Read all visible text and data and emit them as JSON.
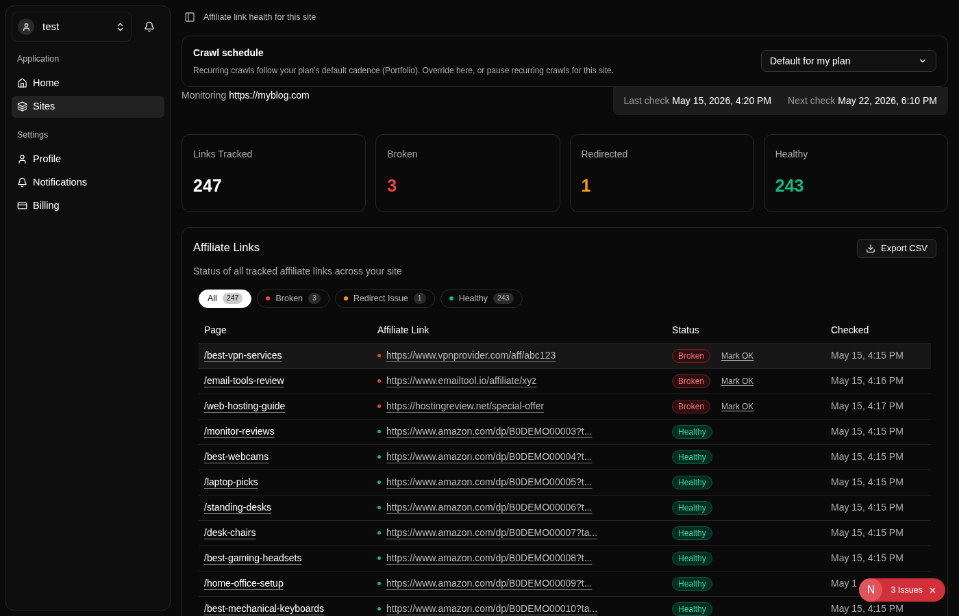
{
  "sidebar": {
    "user": {
      "name": "test"
    },
    "sections": [
      {
        "title": "Application",
        "items": [
          {
            "label": "Home",
            "selected": false
          },
          {
            "label": "Sites",
            "selected": true
          }
        ]
      },
      {
        "title": "Settings",
        "items": [
          {
            "label": "Profile",
            "selected": false
          },
          {
            "label": "Notifications",
            "selected": false
          },
          {
            "label": "Billing",
            "selected": false
          }
        ]
      }
    ]
  },
  "header": {
    "title": "Affiliate link health for this site"
  },
  "crawl_schedule": {
    "title": "Crawl schedule",
    "description": "Recurring crawls follow your plan’s default cadence (Portfolio). Override here, or pause recurring crawls for this site.",
    "select_value": "Default for my plan"
  },
  "monitoring": {
    "label": "Monitoring",
    "url": "https://myblog.com",
    "last_check_label": "Last check",
    "last_check": "May 15, 2026, 4:20 PM",
    "next_check_label": "Next check",
    "next_check": "May 22, 2026, 6:10 PM"
  },
  "stats": [
    {
      "label": "Links Tracked",
      "value": "247",
      "color": "#ffffff"
    },
    {
      "label": "Broken",
      "value": "3",
      "color": "#ef4444"
    },
    {
      "label": "Redirected",
      "value": "1",
      "color": "#f59e0b"
    },
    {
      "label": "Healthy",
      "value": "243",
      "color": "#10b981"
    }
  ],
  "links_panel": {
    "title": "Affiliate Links",
    "subtitle": "Status of all tracked affiliate links across your site",
    "export_button": "Export CSV",
    "filters": [
      {
        "label": "All",
        "count": "247",
        "selected": true
      },
      {
        "label": "Broken",
        "count": "3",
        "selected": false,
        "color": "#ef4444"
      },
      {
        "label": "Redirect Issue",
        "count": "1",
        "selected": false,
        "color": "#f59e0b"
      },
      {
        "label": "Healthy",
        "count": "243",
        "selected": false,
        "color": "#10b981"
      }
    ],
    "columns": [
      "Page",
      "Affiliate Link",
      "Status",
      "Checked"
    ],
    "rows": [
      {
        "page": "/best-vpn-services",
        "link": "https://www.vpnprovider.com/aff/abc123",
        "status": "Broken",
        "kind": "broken",
        "action": "Mark OK",
        "checked": "May 15, 4:15 PM",
        "selected": true
      },
      {
        "page": "/email-tools-review",
        "link": "https://www.emailtool.io/affiliate/xyz",
        "status": "Broken",
        "kind": "broken",
        "action": "Mark OK",
        "checked": "May 15, 4:16 PM",
        "selected": false
      },
      {
        "page": "/web-hosting-guide",
        "link": "https://hostingreview.net/special-offer",
        "status": "Broken",
        "kind": "broken",
        "action": "Mark OK",
        "checked": "May 15, 4:17 PM",
        "selected": false
      },
      {
        "page": "/monitor-reviews",
        "link": "https://www.amazon.com/dp/B0DEMO00003?t...",
        "status": "Healthy",
        "kind": "healthy",
        "checked": "May 15, 4:15 PM",
        "selected": false
      },
      {
        "page": "/best-webcams",
        "link": "https://www.amazon.com/dp/B0DEMO00004?t...",
        "status": "Healthy",
        "kind": "healthy",
        "checked": "May 15, 4:15 PM",
        "selected": false
      },
      {
        "page": "/laptop-picks",
        "link": "https://www.amazon.com/dp/B0DEMO00005?t...",
        "status": "Healthy",
        "kind": "healthy",
        "checked": "May 15, 4:15 PM",
        "selected": false
      },
      {
        "page": "/standing-desks",
        "link": "https://www.amazon.com/dp/B0DEMO00006?t...",
        "status": "Healthy",
        "kind": "healthy",
        "checked": "May 15, 4:15 PM",
        "selected": false
      },
      {
        "page": "/desk-chairs",
        "link": "https://www.amazon.com/dp/B0DEMO00007?ta...",
        "status": "Healthy",
        "kind": "healthy",
        "checked": "May 15, 4:15 PM",
        "selected": false
      },
      {
        "page": "/best-gaming-headsets",
        "link": "https://www.amazon.com/dp/B0DEMO00008?t...",
        "status": "Healthy",
        "kind": "healthy",
        "checked": "May 15, 4:15 PM",
        "selected": false
      },
      {
        "page": "/home-office-setup",
        "link": "https://www.amazon.com/dp/B0DEMO00009?t...",
        "status": "Healthy",
        "kind": "healthy",
        "checked": "May 1",
        "selected": false
      },
      {
        "page": "/best-mechanical-keyboards",
        "link": "https://www.amazon.com/dp/B0DEMO00010?ta...",
        "status": "Healthy",
        "kind": "healthy",
        "checked": "May 15, 4:15 PM",
        "selected": false
      }
    ]
  },
  "issues_toast": {
    "logo": "N",
    "label": "3 Issues"
  }
}
